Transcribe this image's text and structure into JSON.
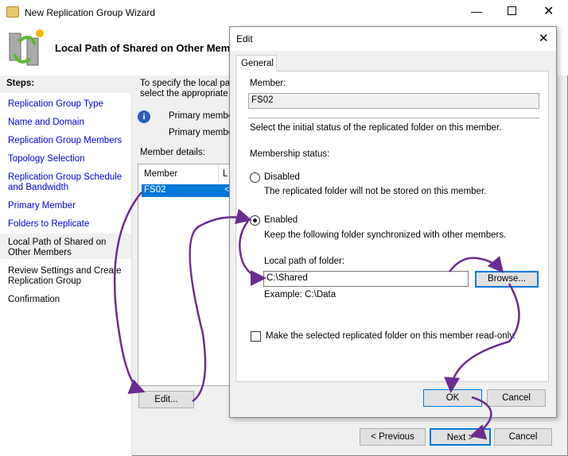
{
  "window": {
    "title": "New Replication Group Wizard",
    "page_title": "Local Path of Shared on Other Members"
  },
  "steps": {
    "header": "Steps:",
    "items": [
      {
        "label": "Replication Group Type"
      },
      {
        "label": "Name and Domain"
      },
      {
        "label": "Replication Group Members"
      },
      {
        "label": "Topology Selection"
      },
      {
        "label": "Replication Group Schedule and Bandwidth"
      },
      {
        "label": "Primary Member"
      },
      {
        "label": "Folders to Replicate"
      },
      {
        "label": "Local Path of Shared on Other Members",
        "current": true
      },
      {
        "label": "Review Settings and Create Replication Group"
      },
      {
        "label": "Confirmation"
      }
    ]
  },
  "main": {
    "intro1": "To specify the local path",
    "intro2": "select the appropriate m",
    "info1": "Primary member:",
    "info2": "Primary member",
    "details_label": "Member details:",
    "col_member": "Member",
    "col_local": "L",
    "row_member": "FS02",
    "row_local": "<",
    "edit_button": "Edit..."
  },
  "footer": {
    "previous": "< Previous",
    "next": "Next >",
    "cancel": "Cancel"
  },
  "dialog": {
    "title": "Edit",
    "tab": "General",
    "member_label": "Member:",
    "member_value": "FS02",
    "select_text": "Select the initial status of the replicated folder on this member.",
    "membership_label": "Membership status:",
    "disabled_label": "Disabled",
    "disabled_desc": "The replicated folder will not be stored on this member.",
    "enabled_label": "Enabled",
    "enabled_desc": "Keep the following folder synchronized with other members.",
    "path_label": "Local path of folder:",
    "path_value": "C:\\Shared",
    "browse": "Browse...",
    "example": "Example: C:\\Data",
    "readonly_label": "Make the selected replicated folder on this member read-only.",
    "ok": "OK",
    "cancel": "Cancel",
    "selected_status": "Enabled",
    "readonly_checked": false
  },
  "colors": {
    "accent": "#0078d7",
    "link": "#0000e0",
    "annotation": "#6b2c91"
  }
}
